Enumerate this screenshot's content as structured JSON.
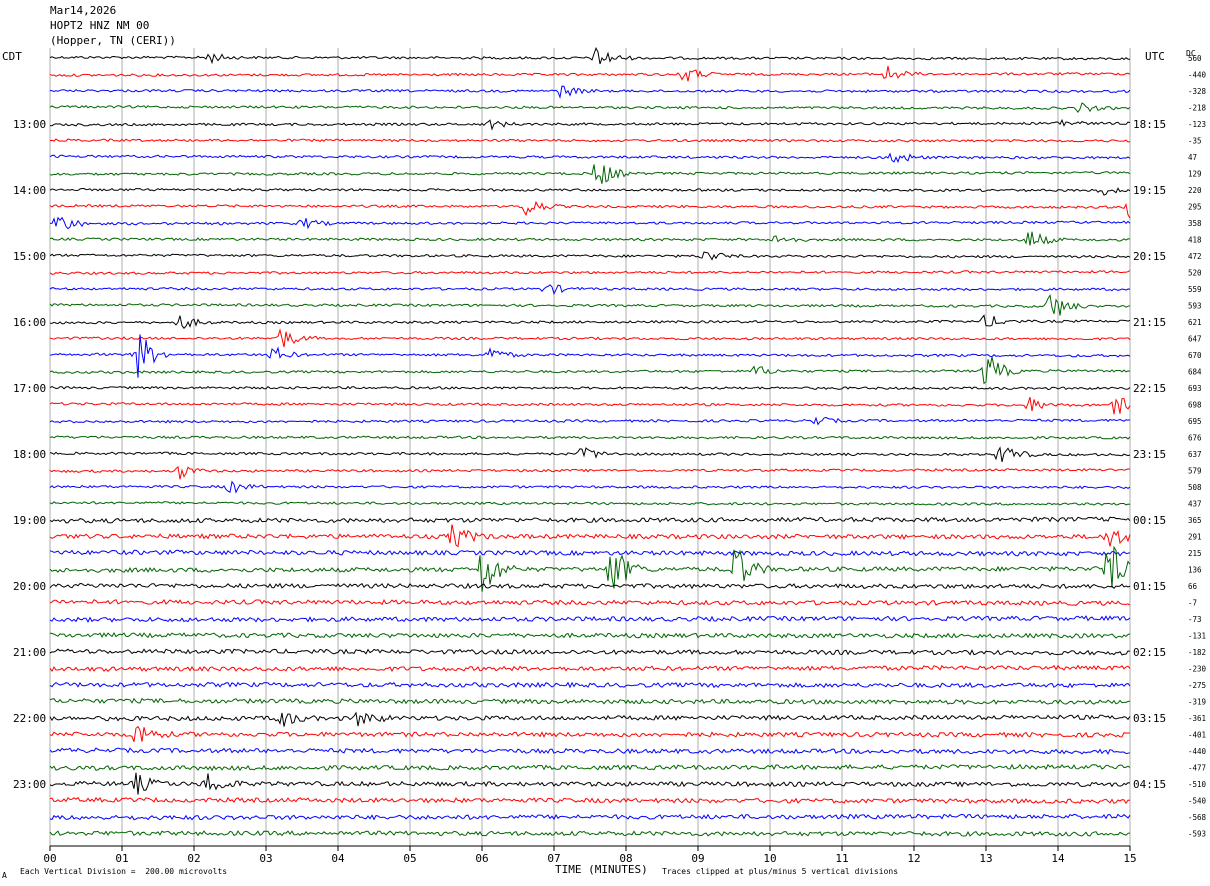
{
  "header": {
    "date": "Mar14,2026",
    "station": "HOPT2 HNZ NM 00",
    "location": "(Hopper, TN (CERI))"
  },
  "left_timezone": "CDT",
  "right_timezone": "UTC",
  "dc_label": "DC",
  "footer": {
    "scale_note": "Each Vertical Division =  200.00 microvolts",
    "clip_note": "Traces clipped at plus/minus 5 vertical divisions",
    "corner_mark": "A"
  },
  "chart_data": {
    "type": "line",
    "xlabel": "TIME (MINUTES)",
    "xlim": [
      0,
      15
    ],
    "x_ticks": [
      "00",
      "01",
      "02",
      "03",
      "04",
      "05",
      "06",
      "07",
      "08",
      "09",
      "10",
      "11",
      "12",
      "13",
      "14",
      "15"
    ],
    "trace_colors": [
      "#000000",
      "#ff0000",
      "#0000ff",
      "#006400"
    ],
    "trace_count": 48,
    "minutes_per_trace": 15,
    "left_hour_labels": [
      {
        "row": 4,
        "label": "13:00"
      },
      {
        "row": 8,
        "label": "14:00"
      },
      {
        "row": 12,
        "label": "15:00"
      },
      {
        "row": 16,
        "label": "16:00"
      },
      {
        "row": 20,
        "label": "17:00"
      },
      {
        "row": 24,
        "label": "18:00"
      },
      {
        "row": 28,
        "label": "19:00"
      },
      {
        "row": 32,
        "label": "20:00"
      },
      {
        "row": 36,
        "label": "21:00"
      },
      {
        "row": 40,
        "label": "22:00"
      },
      {
        "row": 44,
        "label": "23:00"
      }
    ],
    "right_hour_labels": [
      {
        "row": 4,
        "label": "18:15"
      },
      {
        "row": 8,
        "label": "19:15"
      },
      {
        "row": 12,
        "label": "20:15"
      },
      {
        "row": 16,
        "label": "21:15"
      },
      {
        "row": 20,
        "label": "22:15"
      },
      {
        "row": 24,
        "label": "23:15"
      },
      {
        "row": 28,
        "label": "00:15"
      },
      {
        "row": 32,
        "label": "01:15"
      },
      {
        "row": 36,
        "label": "02:15"
      },
      {
        "row": 40,
        "label": "03:15"
      },
      {
        "row": 44,
        "label": "04:15"
      }
    ],
    "dc_offsets": [
      "560",
      "-440",
      "-328",
      "-218",
      "-123",
      "-35",
      "47",
      "129",
      "220",
      "295",
      "358",
      "418",
      "472",
      "520",
      "559",
      "593",
      "621",
      "647",
      "670",
      "684",
      "693",
      "698",
      "695",
      "676",
      "637",
      "579",
      "508",
      "437",
      "365",
      "291",
      "215",
      "136",
      "66",
      "-7",
      "-73",
      "-131",
      "-182",
      "-230",
      "-275",
      "-319",
      "-361",
      "-401",
      "-440",
      "-477",
      "-510",
      "-540",
      "-568",
      "-593"
    ],
    "events": [
      {
        "row": 0,
        "minute": 2.2,
        "amp": 6
      },
      {
        "row": 0,
        "minute": 7.6,
        "amp": 12
      },
      {
        "row": 1,
        "minute": 8.8,
        "amp": 10
      },
      {
        "row": 1,
        "minute": 11.6,
        "amp": 10
      },
      {
        "row": 2,
        "minute": 7.1,
        "amp": 7
      },
      {
        "row": 3,
        "minute": 14.3,
        "amp": 5
      },
      {
        "row": 4,
        "minute": 6.1,
        "amp": 5
      },
      {
        "row": 4,
        "minute": 14.0,
        "amp": 5
      },
      {
        "row": 6,
        "minute": 11.7,
        "amp": 9
      },
      {
        "row": 7,
        "minute": 7.6,
        "amp": 18
      },
      {
        "row": 8,
        "minute": 14.6,
        "amp": 5
      },
      {
        "row": 9,
        "minute": 6.6,
        "amp": 12
      },
      {
        "row": 9,
        "minute": 15.0,
        "amp": 20
      },
      {
        "row": 10,
        "minute": 0.1,
        "amp": 12
      },
      {
        "row": 10,
        "minute": 3.5,
        "amp": 6
      },
      {
        "row": 11,
        "minute": 10.1,
        "amp": 6
      },
      {
        "row": 11,
        "minute": 13.6,
        "amp": 12
      },
      {
        "row": 12,
        "minute": 9.1,
        "amp": 7
      },
      {
        "row": 14,
        "minute": 6.9,
        "amp": 7
      },
      {
        "row": 15,
        "minute": 13.9,
        "amp": 18
      },
      {
        "row": 16,
        "minute": 1.8,
        "amp": 8
      },
      {
        "row": 16,
        "minute": 13.0,
        "amp": 8
      },
      {
        "row": 17,
        "minute": 3.2,
        "amp": 12
      },
      {
        "row": 18,
        "minute": 1.2,
        "amp": 30
      },
      {
        "row": 18,
        "minute": 3.1,
        "amp": 8
      },
      {
        "row": 18,
        "minute": 6.1,
        "amp": 8
      },
      {
        "row": 19,
        "minute": 13.0,
        "amp": 22
      },
      {
        "row": 19,
        "minute": 9.8,
        "amp": 6
      },
      {
        "row": 21,
        "minute": 14.8,
        "amp": 11
      },
      {
        "row": 21,
        "minute": 13.6,
        "amp": 8
      },
      {
        "row": 22,
        "minute": 10.6,
        "amp": 6
      },
      {
        "row": 24,
        "minute": 7.4,
        "amp": 8
      },
      {
        "row": 24,
        "minute": 13.2,
        "amp": 14
      },
      {
        "row": 25,
        "minute": 1.8,
        "amp": 8
      },
      {
        "row": 26,
        "minute": 2.5,
        "amp": 7
      },
      {
        "row": 29,
        "minute": 5.6,
        "amp": 14
      },
      {
        "row": 29,
        "minute": 14.7,
        "amp": 12
      },
      {
        "row": 31,
        "minute": 6.0,
        "amp": 30
      },
      {
        "row": 31,
        "minute": 7.8,
        "amp": 30
      },
      {
        "row": 31,
        "minute": 9.5,
        "amp": 28
      },
      {
        "row": 31,
        "minute": 14.7,
        "amp": 32
      },
      {
        "row": 40,
        "minute": 3.2,
        "amp": 9
      },
      {
        "row": 40,
        "minute": 4.3,
        "amp": 9
      },
      {
        "row": 41,
        "minute": 1.2,
        "amp": 14
      },
      {
        "row": 44,
        "minute": 1.2,
        "amp": 10
      },
      {
        "row": 44,
        "minute": 2.2,
        "amp": 12
      }
    ]
  }
}
